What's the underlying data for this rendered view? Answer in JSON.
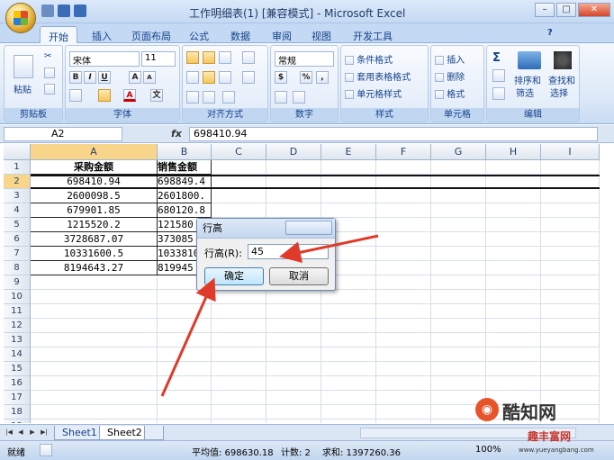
{
  "window": {
    "title": "工作明细表(1) [兼容模式] - Microsoft Excel",
    "min": "–",
    "max": "□",
    "close": "✕"
  },
  "ribbon_tabs": [
    "开始",
    "插入",
    "页面布局",
    "公式",
    "数据",
    "审阅",
    "视图",
    "开发工具"
  ],
  "ribbon": {
    "clipboard": {
      "label": "剪贴板",
      "paste": "粘贴"
    },
    "font": {
      "label": "字体",
      "name": "宋体",
      "size": "11",
      "bold": "B",
      "italic": "I",
      "underline": "U",
      "grow": "A",
      "shrink": "A",
      "font_color": "A",
      "phonetic": "文"
    },
    "alignment": {
      "label": "对齐方式"
    },
    "number": {
      "label": "数字",
      "format": "常规",
      "percent": "%",
      "comma": ",",
      "currency": "$"
    },
    "styles": {
      "label": "样式",
      "conditional": "条件格式",
      "table": "套用表格格式",
      "cell_styles": "单元格样式"
    },
    "cells": {
      "label": "单元格",
      "insert": "插入",
      "delete": "删除",
      "format": "格式"
    },
    "editing": {
      "label": "编辑",
      "sort": "排序和",
      "sort2": "筛选",
      "find": "查找和",
      "find2": "选择",
      "sum": "Σ"
    }
  },
  "formula_bar": {
    "name_box": "A2",
    "fx": "fx",
    "value": "698410.94"
  },
  "columns": [
    "A",
    "B",
    "C",
    "D",
    "E",
    "F",
    "G",
    "H",
    "I"
  ],
  "rows": [
    [
      "采购金额",
      "销售金额"
    ],
    [
      "698410.94",
      "698849.4"
    ],
    [
      "2600098.5",
      "2601800."
    ],
    [
      "679901.85",
      "680120.8"
    ],
    [
      "1215520.2",
      "121580"
    ],
    [
      "3728687.07",
      "373085"
    ],
    [
      "10331600.5",
      "1033810"
    ],
    [
      "8194643.27",
      "819945"
    ]
  ],
  "row_numbers": [
    "1",
    "2",
    "3",
    "4",
    "5",
    "6",
    "7",
    "8",
    "9",
    "10",
    "11",
    "12",
    "13",
    "14",
    "15",
    "16",
    "17",
    "18",
    "19"
  ],
  "dialog": {
    "title": "行高",
    "label": "行高(R):",
    "value": "45",
    "ok": "确定",
    "cancel": "取消"
  },
  "sheets": [
    "Sheet1",
    "Sheet2"
  ],
  "status": {
    "ready": "就绪",
    "average": "平均值: 698630.18",
    "count": "计数: 2",
    "sum": "求和: 1397260.36",
    "zoom": "100%"
  },
  "watermark": {
    "brand": "酷知网",
    "site_name": "趣丰富网",
    "url": "www.yueyangbang.com"
  },
  "colors": {
    "accent": "#15428b",
    "arrow": "#e03a2a",
    "selected_header": "#f9d58b"
  }
}
